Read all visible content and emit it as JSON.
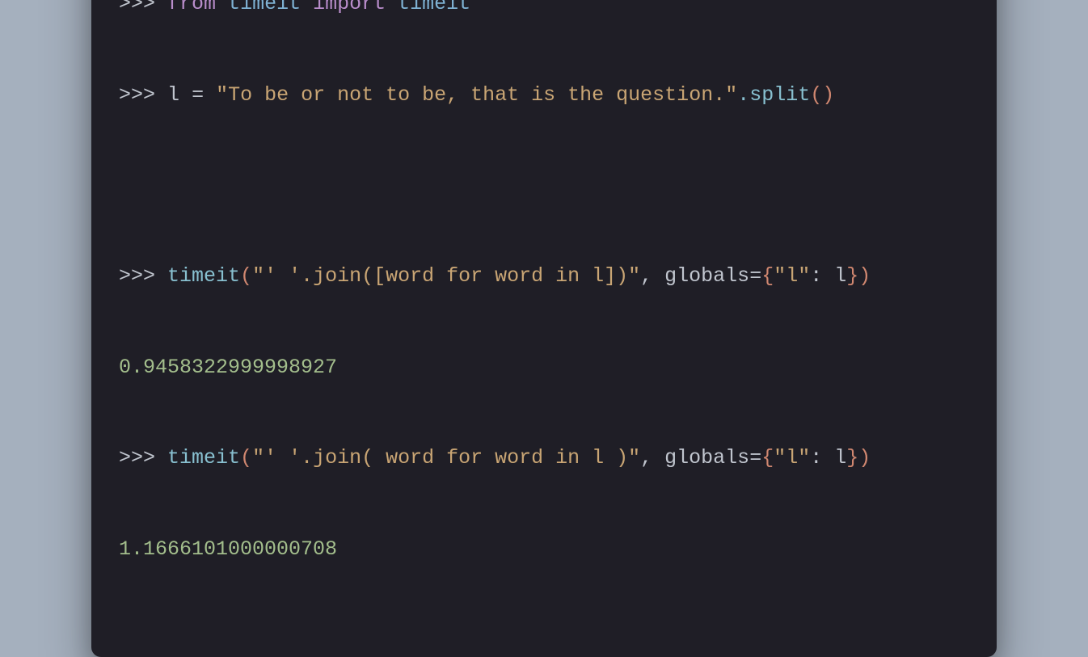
{
  "prompt": ">>>",
  "code": {
    "line1": {
      "from": "from",
      "module": "timeit",
      "import": "import",
      "name": "timeit"
    },
    "line2": {
      "var": "l",
      "op": "=",
      "string": "\"To be or not to be, that is the question.\"",
      "method": ".split",
      "parens": "()"
    },
    "line3": {
      "func": "timeit",
      "open": "(",
      "string": "\"' '.join([word for word in l])\"",
      "comma": ", ",
      "kwarg": "globals",
      "eq": "=",
      "brace_open": "{",
      "key": "\"l\"",
      "colon": ": ",
      "val": "l",
      "brace_close": "}",
      "close": ")"
    },
    "result1": "0.9458322999998927",
    "line4": {
      "func": "timeit",
      "open": "(",
      "string": "\"' '.join( word for word in l )\"",
      "comma": ", ",
      "kwarg": "globals",
      "eq": "=",
      "brace_open": "{",
      "key": "\"l\"",
      "colon": ": ",
      "val": "l",
      "brace_close": "}",
      "close": ")"
    },
    "result2": "1.1666101000000708"
  },
  "colors": {
    "background": "#a5b0be",
    "terminal": "#1f1e26",
    "red": "#ff5f56",
    "yellow": "#ffbd2e",
    "green": "#27c93f"
  }
}
